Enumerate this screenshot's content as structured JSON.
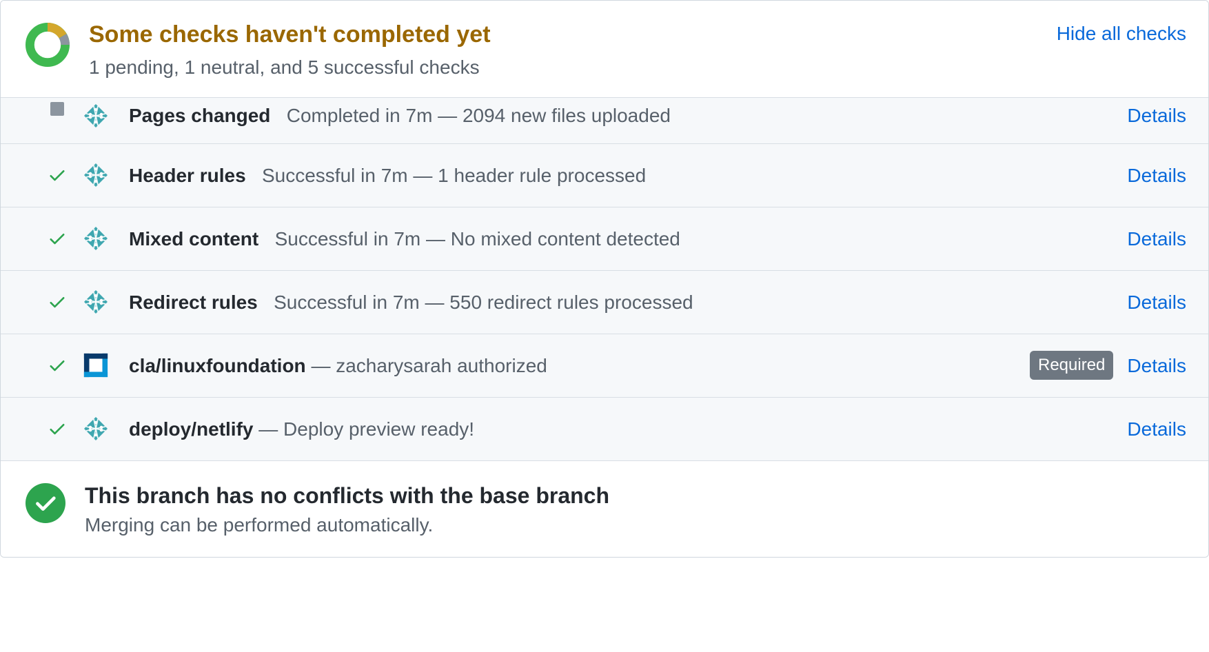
{
  "header": {
    "title": "Some checks haven't completed yet",
    "subtitle": "1 pending, 1 neutral, and 5 successful checks",
    "hide_link": "Hide all checks"
  },
  "checks": [
    {
      "status": "neutral",
      "avatar": "netlify",
      "name": "Pages changed",
      "sep": "   ",
      "desc": "Completed in 7m — 2094 new files uploaded",
      "required": false,
      "details": "Details",
      "clipped": true
    },
    {
      "status": "success",
      "avatar": "netlify",
      "name": "Header rules",
      "sep": "   ",
      "desc": "Successful in 7m — 1 header rule processed",
      "required": false,
      "details": "Details",
      "clipped": false
    },
    {
      "status": "success",
      "avatar": "netlify",
      "name": "Mixed content",
      "sep": "   ",
      "desc": "Successful in 7m — No mixed content detected",
      "required": false,
      "details": "Details",
      "clipped": false
    },
    {
      "status": "success",
      "avatar": "netlify",
      "name": "Redirect rules",
      "sep": "   ",
      "desc": "Successful in 7m — 550 redirect rules processed",
      "required": false,
      "details": "Details",
      "clipped": false
    },
    {
      "status": "success",
      "avatar": "lf",
      "name": "cla/linuxfoundation",
      "sep": " — ",
      "desc": "zacharysarah authorized",
      "required": true,
      "required_label": "Required",
      "details": "Details",
      "clipped": false
    },
    {
      "status": "success",
      "avatar": "netlify",
      "name": "deploy/netlify",
      "sep": " — ",
      "desc": "Deploy preview ready!",
      "required": false,
      "details": "Details",
      "clipped": false
    }
  ],
  "footer": {
    "title": "This branch has no conflicts with the base branch",
    "subtitle": "Merging can be performed automatically."
  },
  "colors": {
    "pending": "#bf8700",
    "success": "#2da44e",
    "neutral": "#8c959f",
    "link": "#0969da"
  }
}
